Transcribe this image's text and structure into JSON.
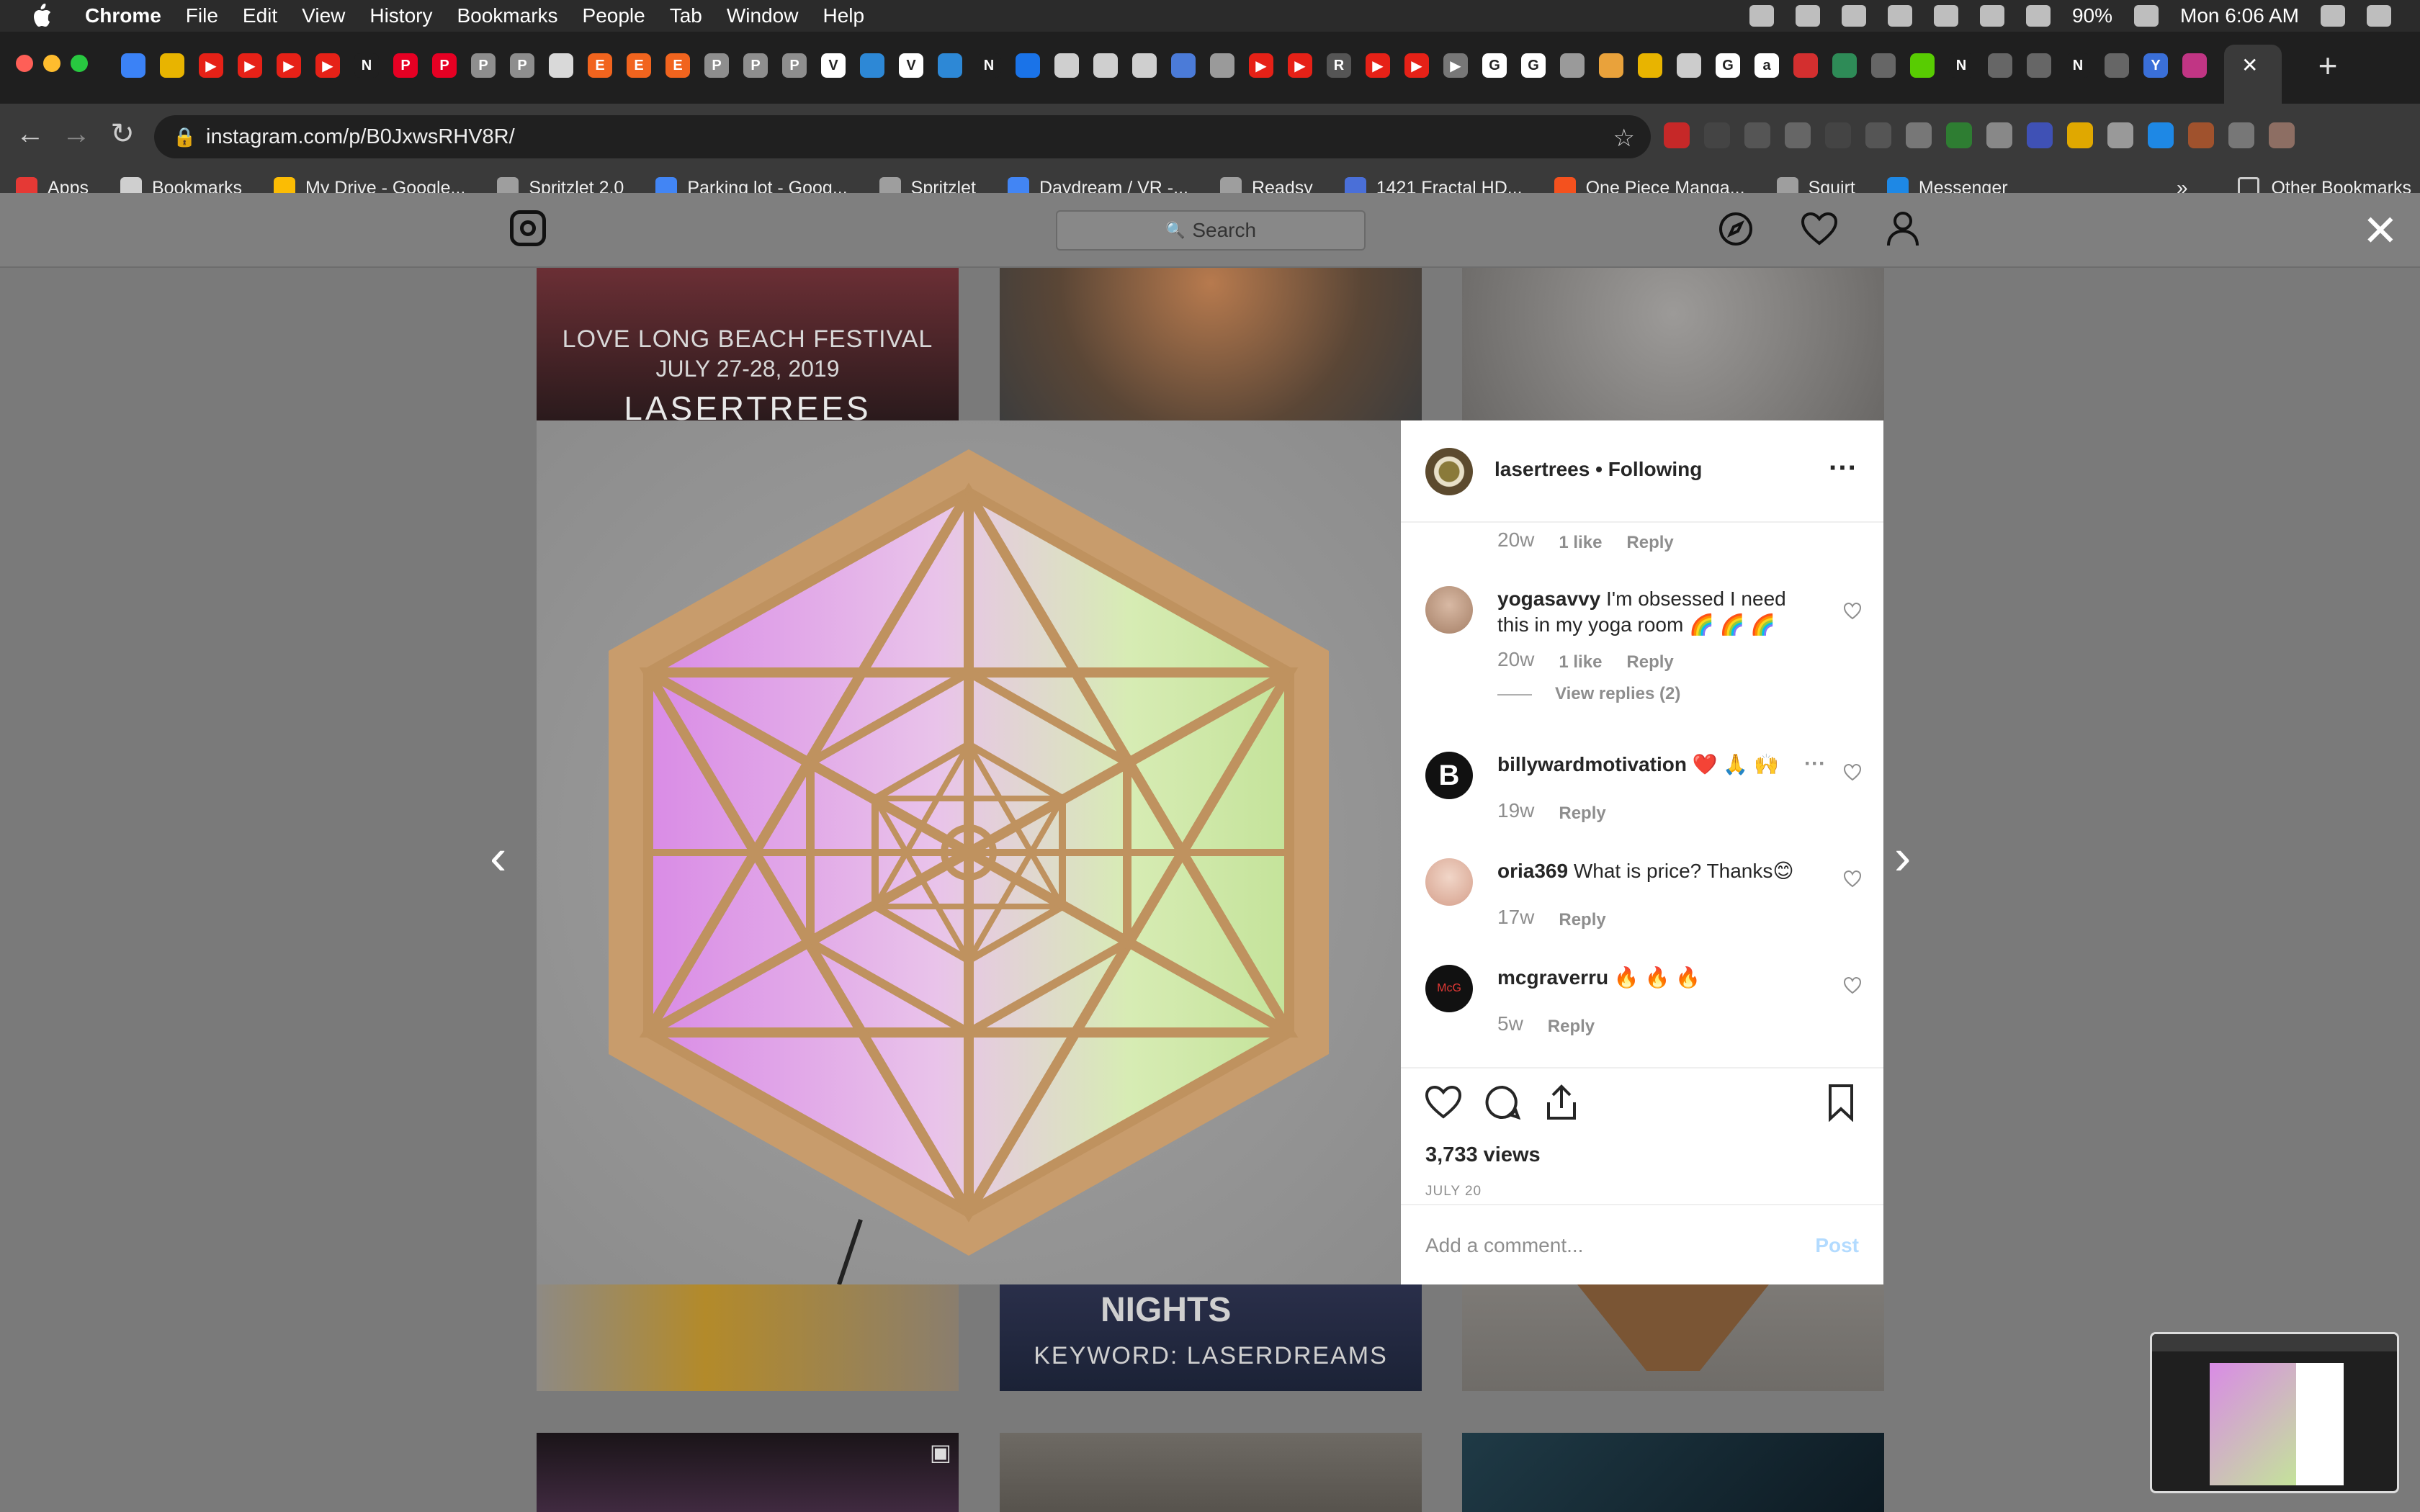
{
  "menubar": {
    "items": [
      "Chrome",
      "File",
      "Edit",
      "View",
      "History",
      "Bookmarks",
      "People",
      "Tab",
      "Window",
      "Help"
    ],
    "battery": "90%",
    "clock": "Mon 6:06 AM"
  },
  "tabs": {
    "favicons": [
      {
        "glyph": "",
        "color": "#3b82f6"
      },
      {
        "glyph": "",
        "color": "#e8b400"
      },
      {
        "glyph": "▶",
        "color": "#e62117"
      },
      {
        "glyph": "▶",
        "color": "#e62117"
      },
      {
        "glyph": "▶",
        "color": "#e62117"
      },
      {
        "glyph": "▶",
        "color": "#e62117"
      },
      {
        "glyph": "N",
        "color": "#1f1f1f"
      },
      {
        "glyph": "P",
        "color": "#e60023"
      },
      {
        "glyph": "P",
        "color": "#e60023"
      },
      {
        "glyph": "P",
        "color": "#8e8e8e"
      },
      {
        "glyph": "P",
        "color": "#8e8e8e"
      },
      {
        "glyph": "",
        "color": "#d9d9d9"
      },
      {
        "glyph": "E",
        "color": "#f1641e"
      },
      {
        "glyph": "E",
        "color": "#f1641e"
      },
      {
        "glyph": "E",
        "color": "#f1641e"
      },
      {
        "glyph": "P",
        "color": "#8e8e8e"
      },
      {
        "glyph": "P",
        "color": "#8e8e8e"
      },
      {
        "glyph": "P",
        "color": "#8e8e8e"
      },
      {
        "glyph": "V",
        "color": "#ffffff"
      },
      {
        "glyph": "",
        "color": "#2d88d6"
      },
      {
        "glyph": "V",
        "color": "#ffffff"
      },
      {
        "glyph": "",
        "color": "#2d88d6"
      },
      {
        "glyph": "N",
        "color": "#1f1f1f"
      },
      {
        "glyph": "",
        "color": "#1a73e8"
      },
      {
        "glyph": "",
        "color": "#cfcfcf"
      },
      {
        "glyph": "",
        "color": "#cfcfcf"
      },
      {
        "glyph": "",
        "color": "#cfcfcf"
      },
      {
        "glyph": "",
        "color": "#4b7bd8"
      },
      {
        "glyph": "",
        "color": "#9a9a9a"
      },
      {
        "glyph": "▶",
        "color": "#e62117"
      },
      {
        "glyph": "▶",
        "color": "#e62117"
      },
      {
        "glyph": "R",
        "color": "#555555"
      },
      {
        "glyph": "▶",
        "color": "#e62117"
      },
      {
        "glyph": "▶",
        "color": "#e62117"
      },
      {
        "glyph": "▶",
        "color": "#777777"
      },
      {
        "glyph": "G",
        "color": "#ffffff"
      },
      {
        "glyph": "G",
        "color": "#ffffff"
      },
      {
        "glyph": "",
        "color": "#9a9a9a"
      },
      {
        "glyph": "",
        "color": "#e9a23b"
      },
      {
        "glyph": "",
        "color": "#e8b400"
      },
      {
        "glyph": "",
        "color": "#cccccc"
      },
      {
        "glyph": "G",
        "color": "#ffffff"
      },
      {
        "glyph": "a",
        "color": "#ffffff"
      },
      {
        "glyph": "",
        "color": "#d32f2f"
      },
      {
        "glyph": "",
        "color": "#2e8b57"
      },
      {
        "glyph": "",
        "color": "#666666"
      },
      {
        "glyph": "",
        "color": "#58cc02"
      },
      {
        "glyph": "N",
        "color": "#1f1f1f"
      },
      {
        "glyph": "",
        "color": "#666666"
      },
      {
        "glyph": "",
        "color": "#666666"
      },
      {
        "glyph": "N",
        "color": "#1f1f1f"
      },
      {
        "glyph": "",
        "color": "#666666"
      },
      {
        "glyph": "Y",
        "color": "#3a6fd8"
      },
      {
        "glyph": "",
        "color": "#c13584"
      }
    ],
    "close_glyph": "✕",
    "new_tab_glyph": "+"
  },
  "toolbar": {
    "url": "instagram.com/p/B0JxwsRHV8R/",
    "extensions": [
      "#c62828",
      "#444",
      "#555",
      "#666",
      "#444",
      "#555",
      "#777",
      "#2e7d32",
      "#888",
      "#3f51b5",
      "#e0a800",
      "#999",
      "#1e88e5",
      "#a0522d",
      "#777",
      "#8d6e63"
    ]
  },
  "bookmarks": {
    "items": [
      {
        "label": "Apps",
        "color": "#e53935"
      },
      {
        "label": "Bookmarks",
        "color": "#cfcfcf"
      },
      {
        "label": "My Drive - Google...",
        "color": "#fbbc04"
      },
      {
        "label": "Spritzlet 2.0",
        "color": "#9e9e9e"
      },
      {
        "label": "Parking lot - Goog...",
        "color": "#4285f4"
      },
      {
        "label": "Spritzlet",
        "color": "#9e9e9e"
      },
      {
        "label": "Daydream / VR -...",
        "color": "#4285f4"
      },
      {
        "label": "Readsy",
        "color": "#9e9e9e"
      },
      {
        "label": "1421 Fractal HD...",
        "color": "#4a6fd8"
      },
      {
        "label": "One Piece Manga...",
        "color": "#f4511e"
      },
      {
        "label": "Squirt",
        "color": "#9e9e9e"
      },
      {
        "label": "Messenger",
        "color": "#1e88e5"
      }
    ],
    "more": "»",
    "other": "Other Bookmarks"
  },
  "instagram": {
    "search_placeholder": "Search",
    "grid_texts": {
      "festival_line1": "LOVE LONG BEACH FESTIVAL",
      "festival_line2": "JULY 27-28, 2019",
      "festival_line3": "LASERTREES",
      "nights": "NIGHTS",
      "keyword": "KEYWORD: LASERDREAMS"
    },
    "post": {
      "username": "lasertrees",
      "following": "• Following",
      "first_meta": {
        "time": "20w",
        "likes": "1 like",
        "reply": "Reply"
      },
      "comments": [
        {
          "user": "yogasavvy",
          "text": "I'm obsessed I need this in my yoga room 🌈 🌈 🌈",
          "time": "20w",
          "likes": "1 like",
          "reply": "Reply",
          "view_replies": "View replies (2)",
          "avatar": "#c9a893"
        },
        {
          "user": "billywardmotivation",
          "text": "❤️ 🙏 🙌",
          "time": "19w",
          "reply": "Reply",
          "avatar": "#111111",
          "avatar_letter": "B"
        },
        {
          "user": "oria369",
          "text": "What is price? Thanks😊",
          "time": "17w",
          "reply": "Reply",
          "avatar": "#e7c3b3"
        },
        {
          "user": "mcgraverru",
          "text": "🔥 🔥 🔥",
          "time": "5w",
          "reply": "Reply",
          "avatar": "#111111",
          "avatar_letter": "McG"
        }
      ],
      "views": "3,733 views",
      "date": "JULY 20",
      "comment_placeholder": "Add a comment...",
      "post_button": "Post"
    }
  },
  "colors": {
    "ig_link": "#b3dbff",
    "light_pink": "#e2a0ea",
    "light_green": "#d9f0b0",
    "wood": "#b5895a"
  }
}
